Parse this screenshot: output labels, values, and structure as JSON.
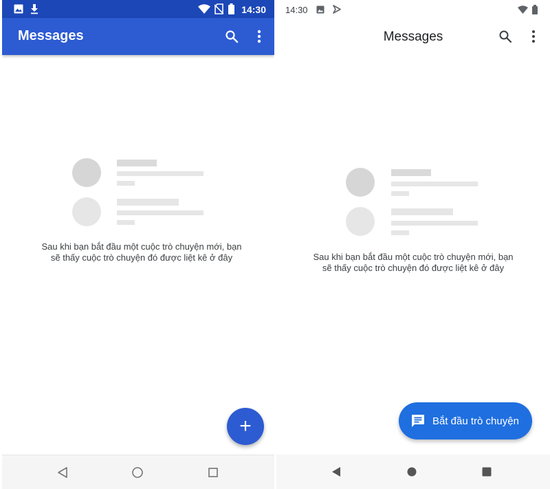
{
  "left": {
    "status_bar": {
      "time": "14:30",
      "left_icons": [
        "image-icon",
        "download-icon"
      ],
      "right_icons": [
        "wifi-icon",
        "no-sim-icon",
        "battery-icon"
      ]
    },
    "app_bar": {
      "title": "Messages",
      "actions": [
        "search-icon",
        "more-vert-icon"
      ]
    },
    "empty_state": {
      "message": "Sau khi bạn bắt đầu một cuộc trò chuyện mới, bạn sẽ thấy cuộc trò chuyện đó được liệt kê ở đây"
    },
    "fab": {
      "label": "+",
      "icon": "plus-icon"
    },
    "nav_bar": {
      "buttons": [
        "back-icon",
        "home-icon",
        "recents-icon"
      ]
    },
    "colors": {
      "status_bar": "#1c47b7",
      "app_bar": "#2d5bd2",
      "fab": "#2d5bd2"
    }
  },
  "right": {
    "status_bar": {
      "time": "14:30",
      "left_icons": [
        "image-icon",
        "notification-icon"
      ],
      "right_icons": [
        "wifi-icon",
        "battery-icon"
      ]
    },
    "app_bar": {
      "title": "Messages",
      "actions": [
        "search-icon",
        "more-vert-icon"
      ]
    },
    "empty_state": {
      "message": "Sau khi bạn bắt đầu một cuộc trò chuyện mới, bạn sẽ thấy cuộc trò chuyện đó được liệt kê ở đây"
    },
    "fab": {
      "label": "Bắt đầu trò chuyện",
      "icon": "chat-icon"
    },
    "nav_bar": {
      "buttons": [
        "back-icon",
        "home-icon",
        "recents-icon"
      ]
    },
    "colors": {
      "fab": "#1f6fe0"
    }
  }
}
